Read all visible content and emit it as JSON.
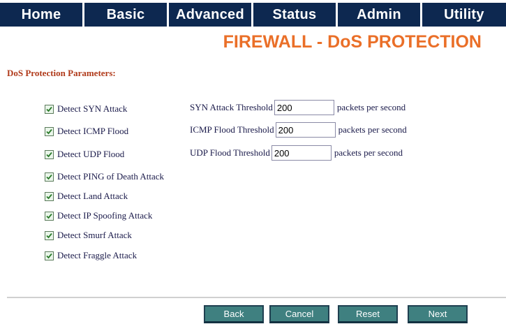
{
  "nav": {
    "items": [
      "Home",
      "Basic",
      "Advanced",
      "Status",
      "Admin",
      "Utility"
    ]
  },
  "page": {
    "title": "FIREWALL - DoS PROTECTION",
    "section_title": "DoS Protection Parameters:"
  },
  "checks": [
    {
      "label": "Detect SYN Attack",
      "checked": true
    },
    {
      "label": "Detect ICMP Flood",
      "checked": true
    },
    {
      "label": "Detect UDP Flood",
      "checked": true
    },
    {
      "label": "Detect PING of Death Attack",
      "checked": true
    },
    {
      "label": "Detect Land Attack",
      "checked": true
    },
    {
      "label": "Detect IP Spoofing Attack",
      "checked": true
    },
    {
      "label": "Detect Smurf Attack",
      "checked": true
    },
    {
      "label": "Detect Fraggle Attack",
      "checked": true
    }
  ],
  "thresholds": [
    {
      "label": "SYN Attack Threshold",
      "value": "200",
      "unit": "packets per second"
    },
    {
      "label": "ICMP Flood Threshold",
      "value": "200",
      "unit": "packets per second"
    },
    {
      "label": "UDP Flood Threshold",
      "value": "200",
      "unit": "packets per second"
    }
  ],
  "buttons": {
    "back": "Back",
    "cancel": "Cancel",
    "reset": "Reset",
    "next": "Next"
  },
  "colors": {
    "nav_bg": "#0d2850",
    "title": "#ea6f28",
    "section": "#b03a1a",
    "button": "#3f8080"
  }
}
